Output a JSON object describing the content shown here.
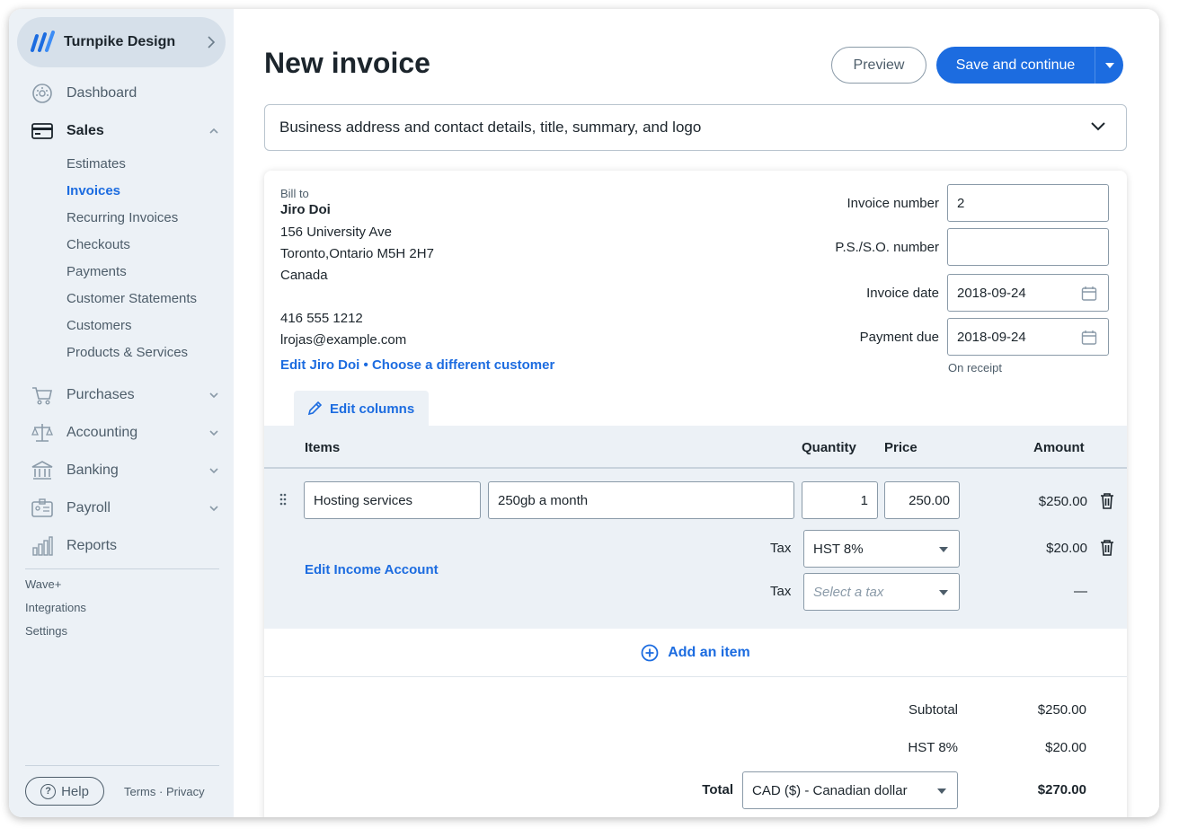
{
  "sidebar": {
    "business_name": "Turnpike Design",
    "nav": [
      {
        "label": "Dashboard",
        "icon": "dashboard-icon"
      },
      {
        "label": "Sales",
        "icon": "sales-card-icon"
      },
      {
        "label": "Purchases",
        "icon": "cart-icon"
      },
      {
        "label": "Accounting",
        "icon": "scale-icon"
      },
      {
        "label": "Banking",
        "icon": "bank-icon"
      },
      {
        "label": "Payroll",
        "icon": "payroll-icon"
      },
      {
        "label": "Reports",
        "icon": "bar-chart-icon"
      }
    ],
    "sales_items": [
      "Estimates",
      "Invoices",
      "Recurring Invoices",
      "Checkouts",
      "Payments",
      "Customer Statements",
      "Customers",
      "Products & Services"
    ],
    "extra": [
      "Wave+",
      "Integrations",
      "Settings"
    ],
    "help": "Help",
    "terms": "Terms",
    "privacy": "Privacy",
    "legal_sep": "·"
  },
  "header": {
    "title": "New invoice",
    "preview": "Preview",
    "save": "Save and continue"
  },
  "accordion": "Business address and contact details, title, summary, and logo",
  "bill_to": {
    "label": "Bill to",
    "name": "Jiro Doi",
    "address1": "156 University Ave",
    "address2": "Toronto,Ontario M5H 2H7",
    "country": "Canada",
    "phone": "416 555 1212",
    "email": "lrojas@example.com",
    "edit_link": "Edit Jiro Doi",
    "link_sep": "•",
    "choose_link": "Choose a different customer"
  },
  "meta": {
    "invoice_number_label": "Invoice number",
    "invoice_number": "2",
    "pso_label": "P.S./S.O. number",
    "pso_value": "",
    "invoice_date_label": "Invoice date",
    "invoice_date": "2018-09-24",
    "payment_due_label": "Payment due",
    "payment_due": "2018-09-24",
    "payment_note": "On receipt"
  },
  "edit_columns": "Edit columns",
  "columns": {
    "items": "Items",
    "quantity": "Quantity",
    "price": "Price",
    "amount": "Amount"
  },
  "line_item": {
    "name": "Hosting services",
    "description": "250gb a month",
    "quantity": "1",
    "price": "250.00",
    "amount": "$250.00",
    "edit_income": "Edit Income Account",
    "tax_label": "Tax",
    "tax1": "HST 8%",
    "tax1_amount": "$20.00",
    "tax2_placeholder": "Select a tax",
    "tax2_amount": "—"
  },
  "add_item": "Add an item",
  "totals": {
    "subtotal_label": "Subtotal",
    "subtotal": "$250.00",
    "tax_label": "HST 8%",
    "tax": "$20.00",
    "total_label": "Total",
    "currency": "CAD ($) - Canadian dollar",
    "total": "$270.00"
  },
  "colors": {
    "accent": "#1c6ce0",
    "sidebar_bg": "#ecf1f6",
    "text": "#1c252c",
    "muted": "#4d5d6a"
  }
}
